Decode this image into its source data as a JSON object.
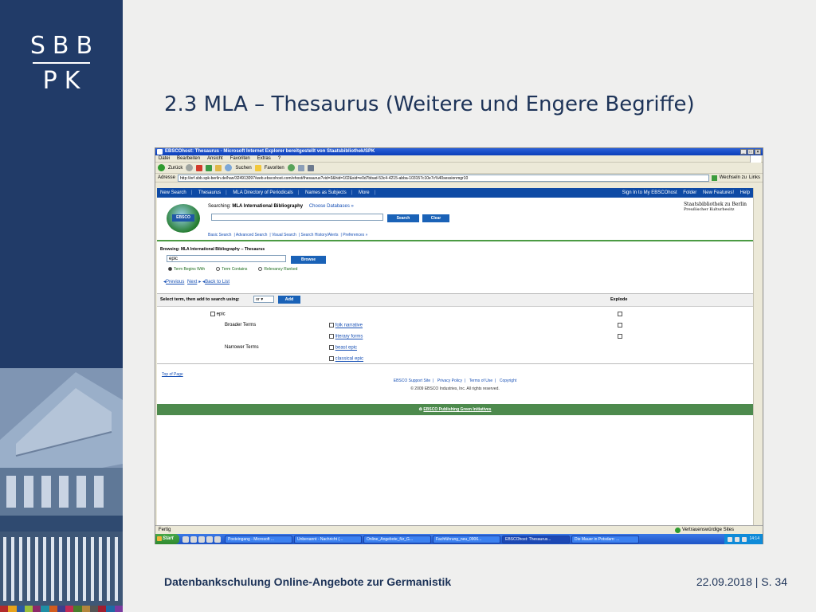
{
  "slide": {
    "logo_top": "SBB",
    "logo_bottom": "PK",
    "title": "2.3 MLA – Thesaurus (Weitere und Engere Begriffe)",
    "footer_left": "Datenbankschulung Online-Angebote zur Germanistik",
    "footer_right": "22.09.2018 | S. 34",
    "strip_colors": [
      "#b22b2b",
      "#e8a21b",
      "#2c5aa0",
      "#9bbf3b",
      "#8c2a68",
      "#1f8fa5",
      "#d25c1e",
      "#3e3e8c",
      "#c22c56",
      "#4a7d2c",
      "#b3863c",
      "#555555",
      "#a01e30",
      "#1e6aa5",
      "#7b3aa0"
    ]
  },
  "browser": {
    "title": "EBSCOhost: Thesaurus - Microsoft Internet Explorer bereitgestellt von Staatsbibliothek/SPK",
    "menu": [
      "Datei",
      "Bearbeiten",
      "Ansicht",
      "Favoriten",
      "Extras",
      "?"
    ],
    "toolbar": {
      "back": "Zurück",
      "search": "Suchen",
      "favorites": "Favoriten"
    },
    "address_label": "Adresse",
    "address": "http://erf.sbb.spk-berlin.de/han/324913097/web.ebscohost.com/ehost/thesaurus?vid=3&hid=102&sid=e0d7bbad-53c4-4215-abba-103157c10e7c%40sessionmgr10",
    "go_label": "Wechseln zu",
    "links_label": "Links",
    "status_left": "Fertig",
    "status_right": "Vertrauenswürdige Sites"
  },
  "ebsco": {
    "nav_left": [
      "New Search",
      "Thesaurus",
      "MLA Directory of Periodicals",
      "Names as Subjects",
      "More"
    ],
    "nav_right": [
      "Sign In to My EBSCOhost",
      "Folder",
      "New Features!",
      "Help"
    ],
    "logo_text": "EBSCO",
    "searching_label": "Searching:",
    "searching_db": "MLA International Bibliography",
    "choose_databases": "Choose Databases »",
    "search_button": "Search",
    "clear_button": "Clear",
    "search_links": [
      "Basic Search",
      "Advanced Search",
      "Visual Search",
      "Search History/Alerts",
      "Preferences »"
    ],
    "brand_line1": "Staatsbibliothek zu Berlin",
    "brand_line2": "Preußischer Kulturbesitz",
    "browsing_label": "Browsing: MLA International Bibliography -- Thesaurus",
    "browse_value": "epic",
    "browse_button": "Browse",
    "radios": [
      "Term Begins With",
      "Term Contains",
      "Relevancy Ranked"
    ],
    "previous": "Previous",
    "next": "Next",
    "back_to_list": "Back to List",
    "select_label": "Select term, then add to search using:",
    "select_value": "or",
    "add_button": "Add",
    "explode_label": "Explode",
    "main_term": "epic",
    "broader_label": "Broader Terms",
    "narrower_label": "Narrower Terms",
    "broader_terms": [
      "folk narrative",
      "literary forms"
    ],
    "narrower_terms": [
      "beast epic",
      "classical epic"
    ],
    "top_of_page": "Top of Page",
    "footer_links": [
      "EBSCO Support Site",
      "Privacy Policy",
      "Terms of Use",
      "Copyright"
    ],
    "copyright": "© 2009 EBSCO Industries, Inc. All rights reserved.",
    "green_bar": "EBSCO Publishing Green Initiatives"
  },
  "taskbar": {
    "start": "Start",
    "tasks": [
      "Posteingang - Microsoft ...",
      "Unbenannt - Nachricht (...",
      "Online_Angebote_für_G...",
      "Fachführung_neu_0906...",
      "EBSCOhost: Thesaurus...",
      "Die Mauer in Potsdam: ..."
    ],
    "clock": "14:14"
  }
}
